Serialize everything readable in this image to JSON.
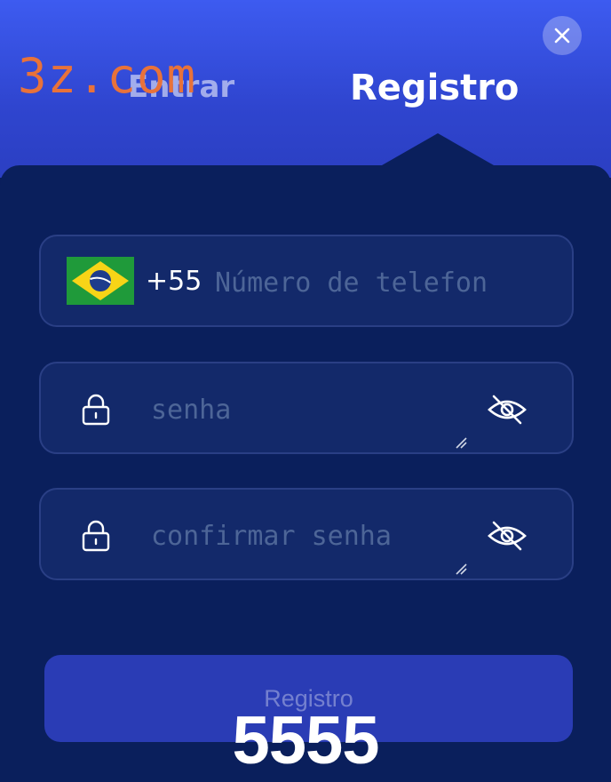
{
  "watermark": {
    "text": "3z.com",
    "color": "#e8723a"
  },
  "tabs": [
    {
      "label": "Entrar",
      "active": false
    },
    {
      "label": "Registro",
      "active": true
    }
  ],
  "close": {
    "icon": "close-icon"
  },
  "form": {
    "phone": {
      "flag_icon": "brazil-flag-icon",
      "dial_code": "+55",
      "placeholder": "Número de telefon"
    },
    "password": {
      "lock_icon": "lock-icon",
      "placeholder": "senha",
      "toggle_icon": "eye-off-icon"
    },
    "confirm_password": {
      "lock_icon": "lock-icon",
      "placeholder": "confirmar senha",
      "toggle_icon": "eye-off-icon"
    }
  },
  "submit": {
    "label": "Registro"
  },
  "overlay": {
    "text": "5555"
  },
  "colors": {
    "header_top": "#3d5bf0",
    "panel": "#0a1f5c",
    "field_bg": "#13296a",
    "button": "#2a3cb5"
  }
}
